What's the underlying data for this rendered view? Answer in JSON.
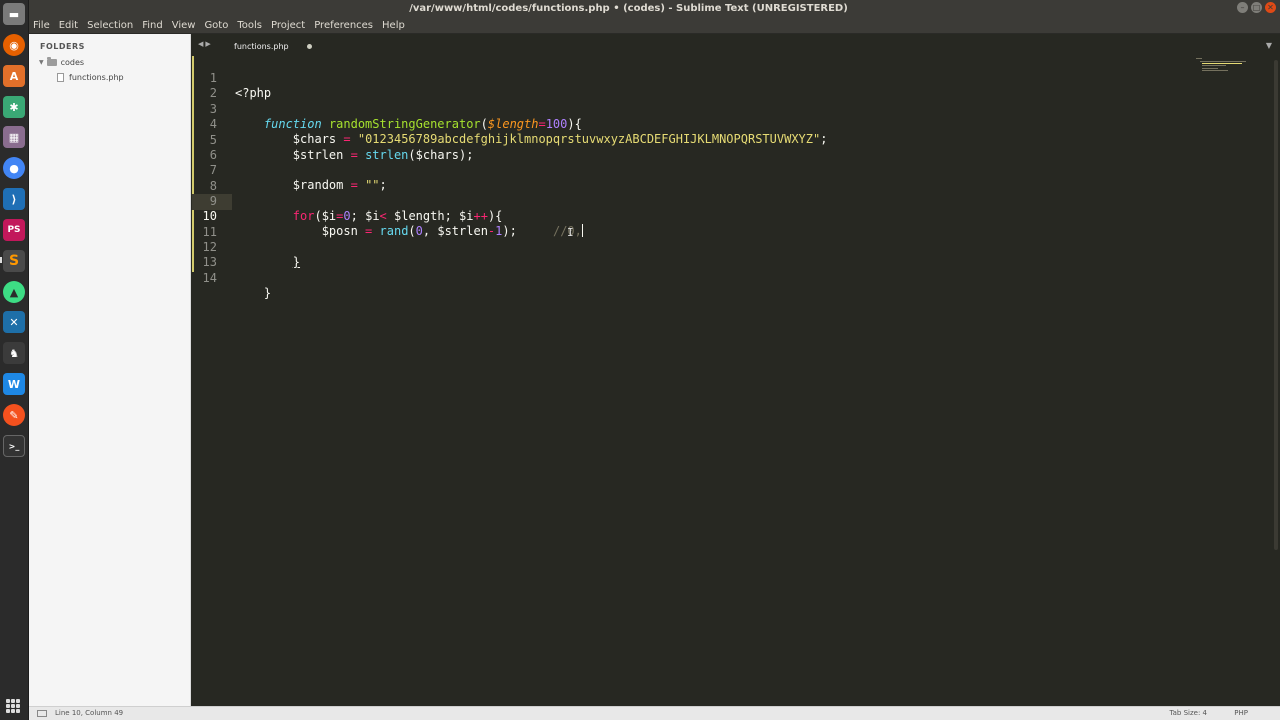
{
  "window": {
    "title": "/var/www/html/codes/functions.php • (codes) - Sublime Text (UNREGISTERED)"
  },
  "menu": [
    "File",
    "Edit",
    "Selection",
    "Find",
    "View",
    "Goto",
    "Tools",
    "Project",
    "Preferences",
    "Help"
  ],
  "sidebar": {
    "header": "FOLDERS",
    "folder": "codes",
    "file": "functions.php"
  },
  "tab": {
    "label": "functions.php"
  },
  "editor": {
    "line_numbers": [
      "1",
      "2",
      "3",
      "4",
      "5",
      "6",
      "7",
      "8",
      "9",
      "10",
      "11",
      "12",
      "13",
      "14"
    ],
    "current_line": 10
  },
  "statusbar": {
    "position": "Line 10, Column 49",
    "tab_size": "Tab Size: 4",
    "syntax": "PHP"
  },
  "colors": {
    "editor_bg": "#272822",
    "keyword": "#66d9ef",
    "function": "#a6e22e",
    "string": "#e6db74",
    "operator": "#f92672",
    "number": "#ae81ff",
    "argument": "#fd971f",
    "comment": "#75715e"
  },
  "launcher_icons": [
    "files-icon",
    "firefox-icon",
    "software-center-icon",
    "slack-icon",
    "photo-icon",
    "chrome-icon",
    "vscode-icon",
    "phpstorm-icon",
    "sublime-icon",
    "android-studio-icon",
    "network-icon",
    "gimp-icon",
    "writer-icon",
    "postman-icon",
    "terminal-icon"
  ]
}
